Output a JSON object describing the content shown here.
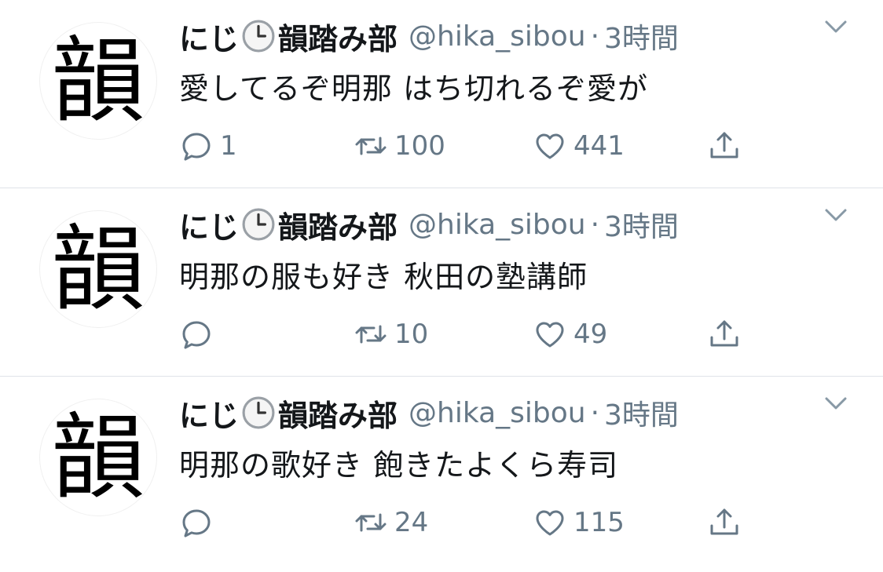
{
  "tweets": [
    {
      "avatar_char": "韻",
      "name_prefix": "にじ",
      "name_suffix": "韻踏み部",
      "handle": "@hika_sibou",
      "dot": "·",
      "time": "3時間",
      "text": "愛してるぞ明那 はち切れるぞ愛が",
      "replies": "1",
      "retweets": "100",
      "likes": "441"
    },
    {
      "avatar_char": "韻",
      "name_prefix": "にじ",
      "name_suffix": "韻踏み部",
      "handle": "@hika_sibou",
      "dot": "·",
      "time": "3時間",
      "text": "明那の服も好き 秋田の塾講師",
      "replies": "",
      "retweets": "10",
      "likes": "49"
    },
    {
      "avatar_char": "韻",
      "name_prefix": "にじ",
      "name_suffix": "韻踏み部",
      "handle": "@hika_sibou",
      "dot": "·",
      "time": "3時間",
      "text": "明那の歌好き 飽きたよくら寿司",
      "replies": "",
      "retweets": "24",
      "likes": "115"
    }
  ],
  "icons": {
    "clock": "clock-emoji-icon",
    "caret": "chevron-down-icon",
    "reply": "reply-icon",
    "retweet": "retweet-icon",
    "like": "heart-icon",
    "share": "share-icon"
  },
  "colors": {
    "text": "#14171a",
    "secondary": "#657786",
    "divider": "#dfe3e8"
  }
}
